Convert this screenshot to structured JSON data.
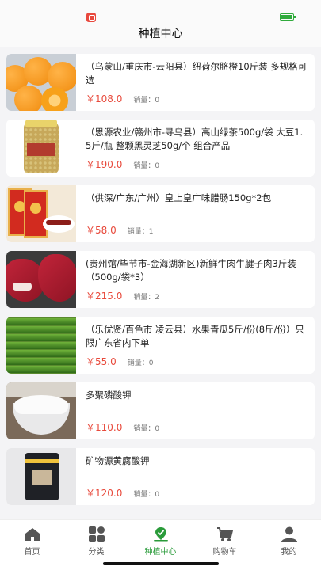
{
  "header": {
    "title": "种植中心"
  },
  "products": [
    {
      "title": "（乌蒙山/重庆市-云阳县）纽荷尔脐橙10斤装 多规格可选",
      "price": "￥108.0",
      "sales": "销量：0",
      "thumb": "oranges-image"
    },
    {
      "title": "（思源农业/赣州市-寻乌县）高山绿茶500g/袋 大豆1.5斤/瓶 整颗黑灵芝50g/个 组合产品",
      "price": "￥190.0",
      "sales": "销量：0",
      "thumb": "soybean-jar-image"
    },
    {
      "title": "（供深/广东/广州）皇上皇广味腊肠150g*2包",
      "price": "￥58.0",
      "sales": "销量：1",
      "thumb": "sausage-package-image"
    },
    {
      "title": "(贵州馆/毕节市-金海湖新区)新鲜牛肉牛腱子肉3斤装（500g/袋*3）",
      "price": "￥215.0",
      "sales": "销量：2",
      "thumb": "beef-image"
    },
    {
      "title": "（乐优贤/百色市 凌云县）水果青瓜5斤/份(8斤/份）只限广东省内下单",
      "price": "￥55.0",
      "sales": "销量：0",
      "thumb": "cucumbers-image"
    },
    {
      "title": "多聚磷酸钾",
      "price": "￥110.0",
      "sales": "销量：0",
      "thumb": "white-powder-bowl-image"
    },
    {
      "title": "矿物源黄腐酸钾",
      "price": "￥120.0",
      "sales": "销量：0",
      "thumb": "fertilizer-bag-image"
    }
  ],
  "tabbar": [
    {
      "label": "首页",
      "icon": "home-icon"
    },
    {
      "label": "分类",
      "icon": "category-icon"
    },
    {
      "label": "种植中心",
      "icon": "planting-center-icon",
      "active": true
    },
    {
      "label": "购物车",
      "icon": "cart-icon"
    },
    {
      "label": "我的",
      "icon": "profile-icon"
    }
  ],
  "colors": {
    "price": "#e84a3c",
    "active_tab": "#2a9b3a"
  }
}
